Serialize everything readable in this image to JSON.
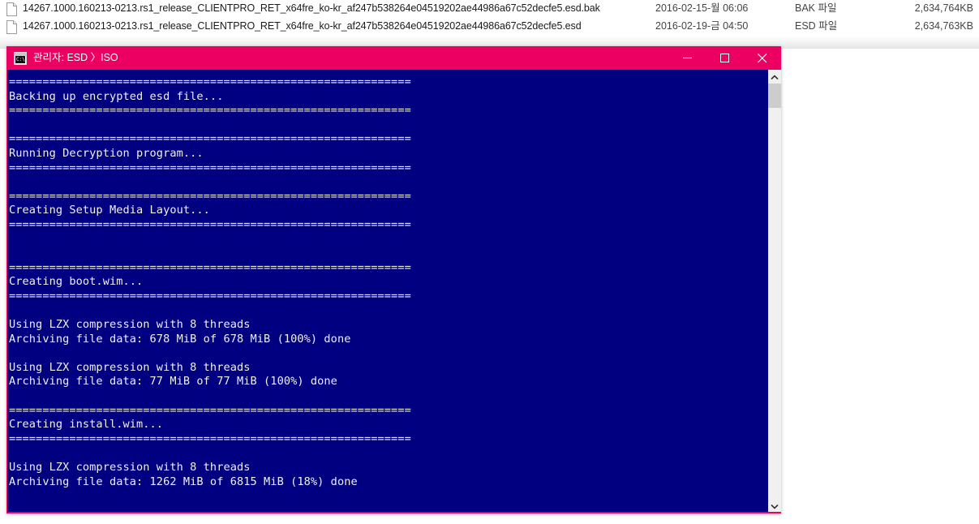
{
  "explorer": {
    "rows": [
      {
        "icon": "file-icon",
        "name": "14267.1000.160213-0213.rs1_release_CLIENTPRO_RET_x64fre_ko-kr_af247b538264e04519202ae44986a67c52decfe5.esd.bak",
        "date": "2016-02-15-월 06:06",
        "type": "BAK 파일",
        "size": "2,634,764KB"
      },
      {
        "icon": "file-icon",
        "name": "14267.1000.160213-0213.rs1_release_CLIENTPRO_RET_x64fre_ko-kr_af247b538264e04519202ae44986a67c52decfe5.esd",
        "date": "2016-02-19-금 04:50",
        "type": "ESD 파일",
        "size": "2,634,763KB"
      }
    ]
  },
  "console_window": {
    "title": "관리자: ESD 〉ISO",
    "icon": "cmd-icon",
    "icon_glyph": "C:\\",
    "titlebar_color": "#ec0062",
    "client_background": "#000080",
    "text_color": "#f0f0f0",
    "controls": {
      "minimize": "minimize-icon",
      "maximize": "maximize-icon",
      "close": "close-icon"
    },
    "scrollbar": {
      "up": "chevron-up-icon",
      "down": "chevron-down-icon",
      "thumb": "scrollbar-thumb"
    },
    "lines": [
      "============================================================",
      "Backing up encrypted esd file...",
      "============================================================",
      "",
      "============================================================",
      "Running Decryption program...",
      "============================================================",
      "",
      "============================================================",
      "Creating Setup Media Layout...",
      "============================================================",
      "",
      "",
      "============================================================",
      "Creating boot.wim...",
      "============================================================",
      "",
      "Using LZX compression with 8 threads",
      "Archiving file data: 678 MiB of 678 MiB (100%) done",
      "",
      "Using LZX compression with 8 threads",
      "Archiving file data: 77 MiB of 77 MiB (100%) done",
      "",
      "============================================================",
      "Creating install.wim...",
      "============================================================",
      "",
      "Using LZX compression with 8 threads",
      "Archiving file data: 1262 MiB of 6815 MiB (18%) done"
    ]
  }
}
